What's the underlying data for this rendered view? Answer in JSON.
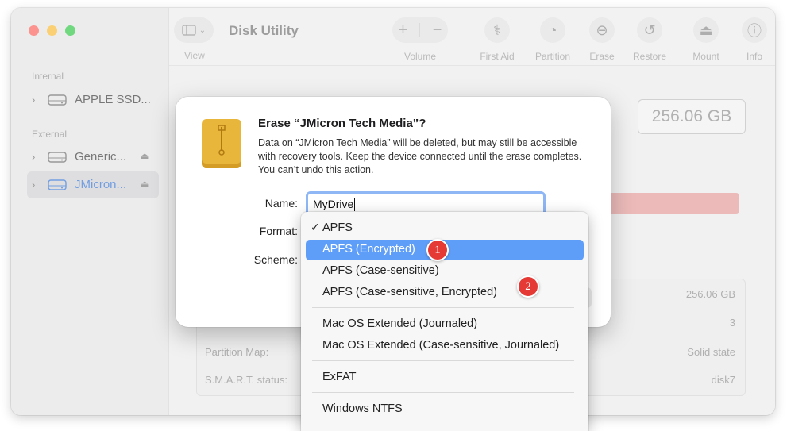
{
  "app": {
    "title": "Disk Utility"
  },
  "sidebar": {
    "internal_label": "Internal",
    "external_label": "External",
    "items": [
      {
        "label": "APPLE SSD..."
      },
      {
        "label": "Generic..."
      },
      {
        "label": "JMicron..."
      }
    ]
  },
  "toolbar": {
    "view": "View",
    "volume": "Volume",
    "first_aid": "First Aid",
    "partition": "Partition",
    "erase": "Erase",
    "restore": "Restore",
    "mount": "Mount",
    "info": "Info"
  },
  "detail": {
    "capacity": "256.06 GB",
    "rows": [
      {
        "key": "",
        "value": "256.06 GB"
      },
      {
        "key": "",
        "value": "3"
      },
      {
        "key": "Partition Map:",
        "value": "Solid state"
      },
      {
        "key": "S.M.A.R.T. status:",
        "value": "disk7"
      }
    ]
  },
  "dialog": {
    "title": "Erase “JMicron Tech Media”?",
    "body": "Data on “JMicron Tech Media” will be deleted, but may still be accessible with recovery tools. Keep the device connected until the erase completes. You can’t undo this action.",
    "name_label": "Name:",
    "name_value": "MyDrive",
    "format_label": "Format:",
    "scheme_label": "Scheme:"
  },
  "format_menu": {
    "items": [
      {
        "label": "APFS",
        "checked": true
      },
      {
        "label": "APFS (Encrypted)",
        "highlighted": true
      },
      {
        "label": "APFS (Case-sensitive)"
      },
      {
        "label": "APFS (Case-sensitive, Encrypted)"
      },
      {
        "label": "Mac OS Extended (Journaled)"
      },
      {
        "label": "Mac OS Extended (Case-sensitive, Journaled)"
      },
      {
        "label": "ExFAT"
      },
      {
        "label": "Windows NTFS"
      }
    ],
    "check_glyph": "✓"
  },
  "badges": {
    "one": "1",
    "two": "2"
  },
  "colors": {
    "accent": "#5f9ef8",
    "badge": "#e53935",
    "usage_bar": "#e59a98",
    "drive_icon": "#e8b63b"
  }
}
